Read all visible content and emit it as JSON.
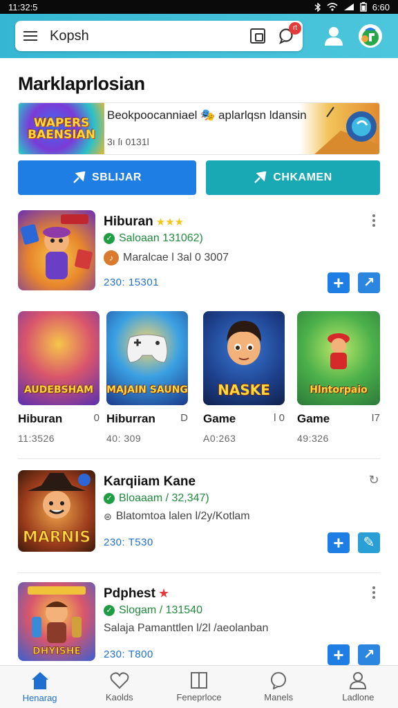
{
  "status_bar": {
    "time": "11:32:5",
    "right_time": "6:60"
  },
  "search": {
    "query": "Kopsh",
    "badge": "rt"
  },
  "page_title": "Marklaprlosian",
  "banner": {
    "logo_text_1": "WAPERS",
    "logo_text_2": "BAENSIAN",
    "title": "Beokpoocanniael 🎭 aplarlqsn ldansin",
    "sub": "3ı ſı 0131l"
  },
  "buttons": {
    "primary": "SBLIJAR",
    "secondary": "CHKAMEN"
  },
  "items": [
    {
      "name": "Hiburan",
      "rating": "★★★",
      "line1": "Saloaan 131062)",
      "line2": "Maralcae l 3al 0 3007",
      "meta": "230: 15301"
    },
    {
      "name": "Karqiiam Kane",
      "line1": "Bloaaam / 32,347)",
      "line2": "Blatomtoa lalen l/2y/Kotlam",
      "meta": "230: T530",
      "thumb_text": "MARNIS"
    },
    {
      "name": "Pdphest",
      "rating": "★",
      "line1": "Slogam / 131540",
      "line2": "Salaja Pamanttlen l/2l /aeolanban",
      "meta": "230: T800",
      "thumb_text": "DHYISHE"
    }
  ],
  "games": [
    {
      "name": "Hiburan",
      "right": "0",
      "sub": "11:3526",
      "thumb_text": "AUDEBSHAM"
    },
    {
      "name": "Hiburran",
      "right": "D",
      "sub": "40: 309",
      "thumb_text": "MAJAIN SAUNG"
    },
    {
      "name": "Game",
      "right": "l  0",
      "sub": "A0:263",
      "thumb_text": "NASKE"
    },
    {
      "name": "Game",
      "right": "I7",
      "sub": "49:326",
      "thumb_text": "Hlntorpaio"
    }
  ],
  "bottom_nav": [
    {
      "label": "Henarag",
      "icon": "home-icon"
    },
    {
      "label": "Kaolds",
      "icon": "heart-icon"
    },
    {
      "label": "Feneprloce",
      "icon": "book-icon"
    },
    {
      "label": "Manels",
      "icon": "chat-icon"
    },
    {
      "label": "Ladlone",
      "icon": "person-icon"
    }
  ],
  "colors": {
    "accent": "#1e7ee4",
    "teal": "#18a9b4",
    "topbar": "#35b7d3",
    "green": "#1f8a3b"
  }
}
